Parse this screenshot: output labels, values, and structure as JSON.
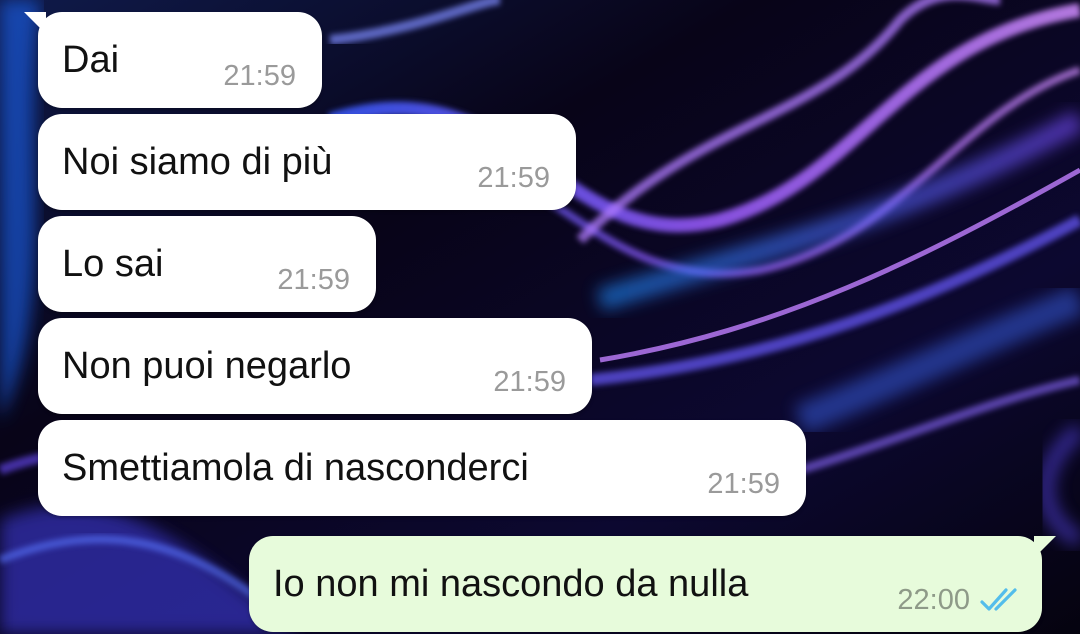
{
  "conversation": {
    "messages": [
      {
        "direction": "incoming",
        "text": "Dai",
        "time": "21:59"
      },
      {
        "direction": "incoming",
        "text": "Noi siamo di più",
        "time": "21:59"
      },
      {
        "direction": "incoming",
        "text": "Lo sai",
        "time": "21:59"
      },
      {
        "direction": "incoming",
        "text": "Non puoi negarlo",
        "time": "21:59"
      },
      {
        "direction": "incoming",
        "text": "Smettiamola di nasconderci",
        "time": "21:59"
      },
      {
        "direction": "outgoing",
        "text": "Io non mi nascondo da nulla",
        "time": "22:00",
        "status_icon": "double-check-read-icon"
      }
    ]
  },
  "colors": {
    "incoming_bubble": "#ffffff",
    "outgoing_bubble": "#e7fbdb",
    "read_ticks": "#53bdeb",
    "wallpaper_base": "#0a0620"
  }
}
